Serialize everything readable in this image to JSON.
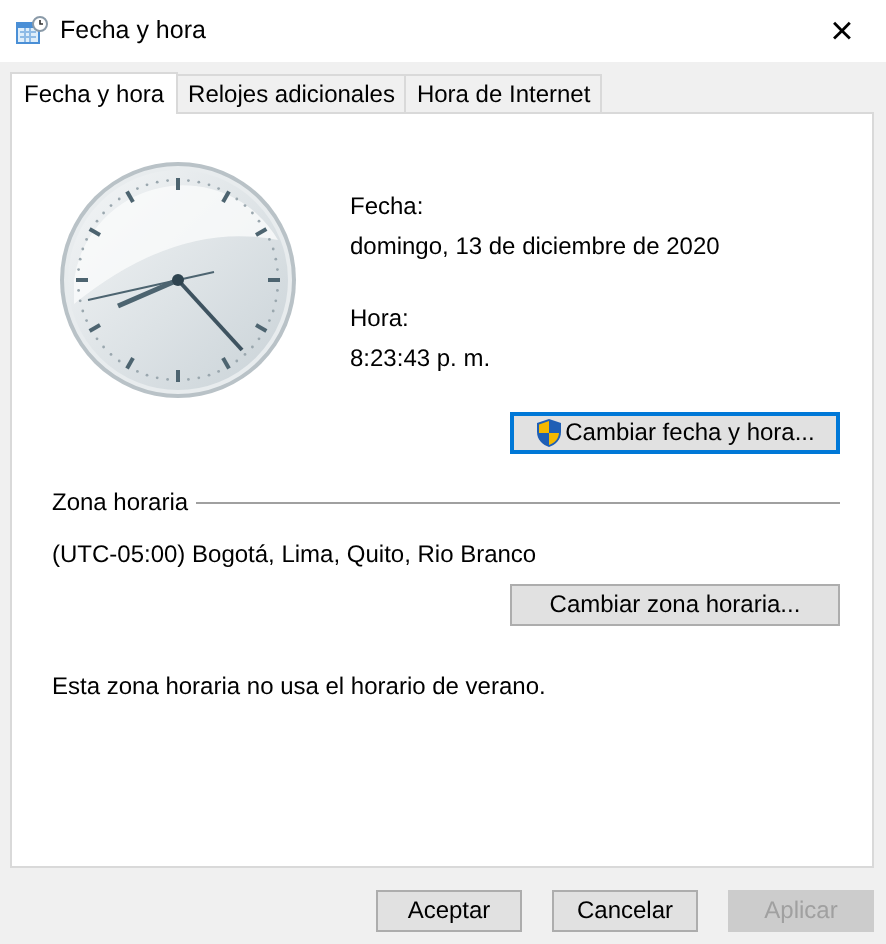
{
  "window": {
    "title": "Fecha y hora",
    "close": "×"
  },
  "tabs": [
    {
      "label": "Fecha y hora",
      "selected": true
    },
    {
      "label": "Relojes adicionales",
      "selected": false
    },
    {
      "label": "Hora de Internet",
      "selected": false
    }
  ],
  "date_label": "Fecha:",
  "date": "domingo, 13 de diciembre de 2020",
  "time_label": "Hora:",
  "time": "8:23:43 p. m.",
  "change_date_button": {
    "label": "Cambiar fecha y hora...",
    "focused": true
  },
  "timezone": {
    "title": "Zona horaria",
    "value": "(UTC-05:00) Bogotá, Lima, Quito, Rio Branco",
    "button": {
      "label": "Cambiar zona horaria...",
      "focused": false
    },
    "note": "Esta zona horaria no usa el horario de verano."
  },
  "buttons": [
    {
      "label": "Aceptar",
      "disabled": false
    },
    {
      "label": "Cancelar",
      "disabled": false
    },
    {
      "label": "Aplicar",
      "disabled": true
    }
  ]
}
